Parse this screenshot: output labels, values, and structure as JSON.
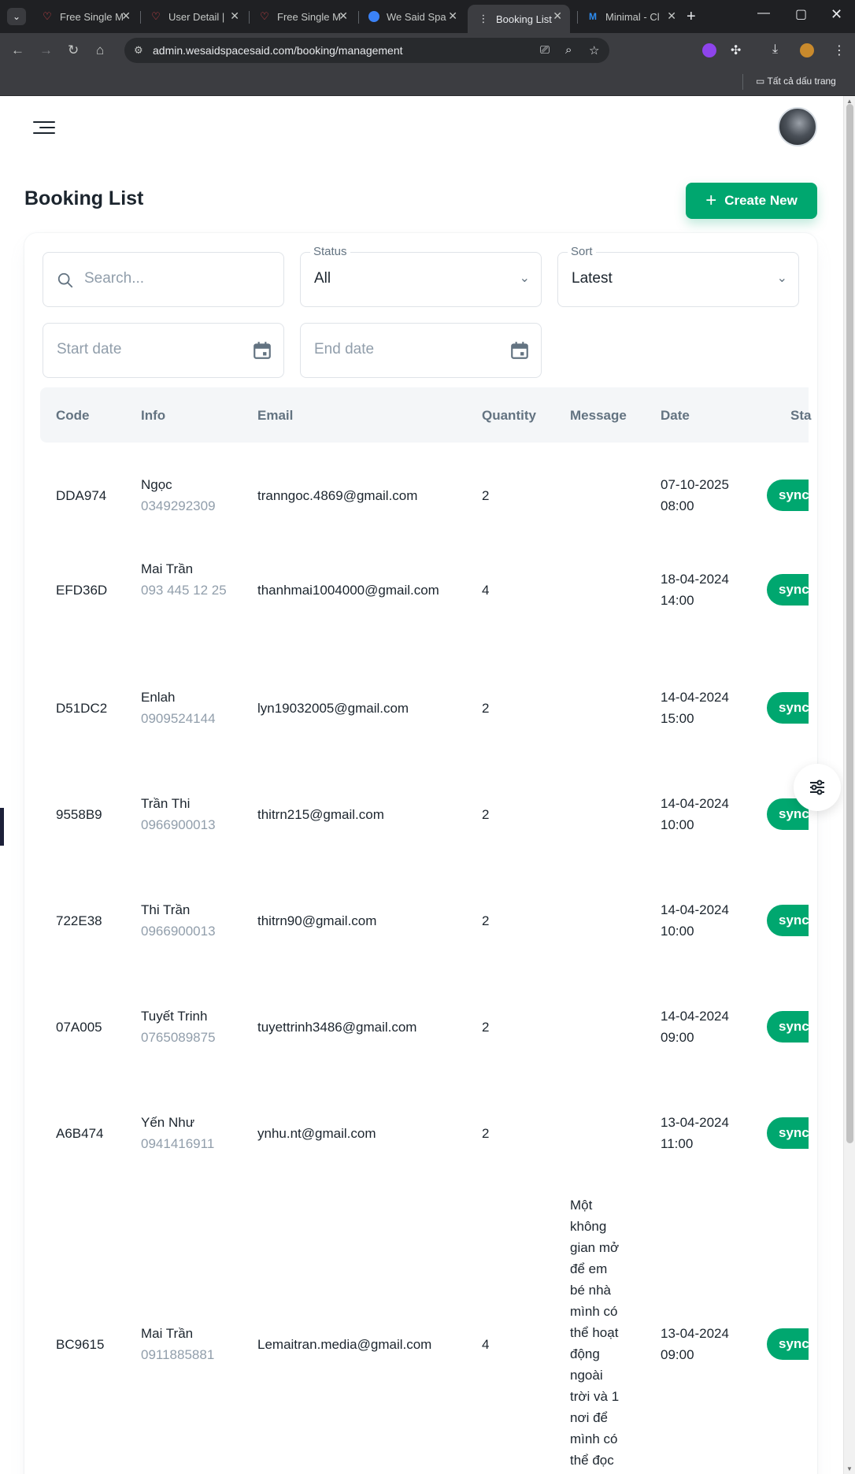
{
  "browser": {
    "tabs": [
      {
        "title": "Free Single M",
        "favicon": "heart-icon"
      },
      {
        "title": "User Detail |",
        "favicon": "heart-icon"
      },
      {
        "title": "Free Single M",
        "favicon": "heart-icon"
      },
      {
        "title": "We Said Spa",
        "favicon": "code-icon"
      },
      {
        "title": "Booking List",
        "favicon": "dots-icon",
        "active": true
      },
      {
        "title": "Minimal - Cl",
        "favicon": "m-logo-icon"
      }
    ],
    "url": "admin.wesaidspacesaid.com/booking/management",
    "bookmarks_label": "Tất cả dấu trang"
  },
  "page": {
    "title": "Booking List",
    "create_label": "Create New"
  },
  "filters": {
    "search_placeholder": "Search...",
    "status_label": "Status",
    "status_value": "All",
    "sort_label": "Sort",
    "sort_value": "Latest",
    "start_placeholder": "Start date",
    "end_placeholder": "End date"
  },
  "table": {
    "columns": [
      "Code",
      "Info",
      "Email",
      "Quantity",
      "Message",
      "Date",
      "Sta"
    ],
    "rows": [
      {
        "code": "DDA974",
        "name": "Ngọc",
        "phone": "0349292309",
        "email": "tranngoc.4869@gmail.com",
        "quantity": "2",
        "message": "",
        "date": "07-10-2025",
        "time": "08:00",
        "status": "synced"
      },
      {
        "code": "EFD36D",
        "name": "Mai Trần",
        "phone": "093 445 12 25",
        "email": "thanhmai1004000@gmail.com",
        "quantity": "4",
        "message": "",
        "date": "18-04-2024",
        "time": "14:00",
        "status": "synced"
      },
      {
        "code": "D51DC2",
        "name": "Enlah",
        "phone": "0909524144",
        "email": "lyn19032005@gmail.com",
        "quantity": "2",
        "message": "",
        "date": "14-04-2024",
        "time": "15:00",
        "status": "synced"
      },
      {
        "code": "9558B9",
        "name": "Trần Thi",
        "phone": "0966900013",
        "email": "thitrn215@gmail.com",
        "quantity": "2",
        "message": "",
        "date": "14-04-2024",
        "time": "10:00",
        "status": "synced"
      },
      {
        "code": "722E38",
        "name": "Thi Trần",
        "phone": "0966900013",
        "email": "thitrn90@gmail.com",
        "quantity": "2",
        "message": "",
        "date": "14-04-2024",
        "time": "10:00",
        "status": "synced"
      },
      {
        "code": "07A005",
        "name": "Tuyết Trinh",
        "phone": "0765089875",
        "email": "tuyettrinh3486@gmail.com",
        "quantity": "2",
        "message": "",
        "date": "14-04-2024",
        "time": "09:00",
        "status": "synced"
      },
      {
        "code": "A6B474",
        "name": "Yến Như",
        "phone": "0941416911",
        "email": "ynhu.nt@gmail.com",
        "quantity": "2",
        "message": "",
        "date": "13-04-2024",
        "time": "11:00",
        "status": "synced"
      },
      {
        "code": "BC9615",
        "name": "Mai Trần",
        "phone": "0911885881",
        "email": "Lemaitran.media@gmail.com",
        "quantity": "4",
        "message": "Một không gian mở để em bé nhà mình có thể hoạt động ngoài trời và 1 nơi để mình có thể đọc",
        "date": "13-04-2024",
        "time": "09:00",
        "status": "synced"
      }
    ]
  },
  "colors": {
    "accent": "#00a76f",
    "text": "#1c252e",
    "muted": "#637381",
    "header_bg": "#f4f6f8"
  }
}
